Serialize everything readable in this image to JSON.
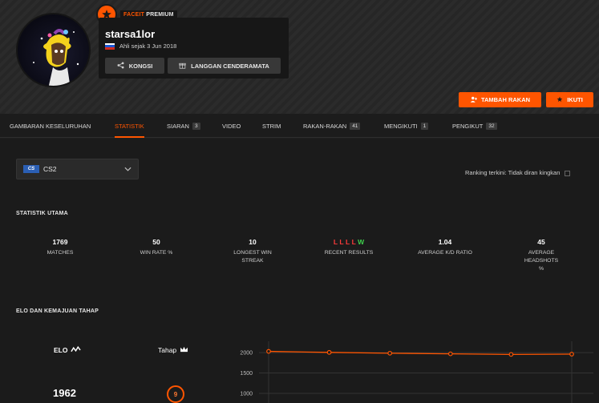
{
  "profile": {
    "badge_brand": "FACEIT",
    "badge_tier": "PREMIUM",
    "username": "starsa1lor",
    "member_since": "Ahli sejak 3 Jun 2018"
  },
  "actions": {
    "share_label": "KONGSI",
    "gift_label": "LANGGAN CENDERAMATA",
    "add_friend_label": "TAMBAH RAKAN",
    "follow_label": "IKUTI"
  },
  "tabs": [
    {
      "label": "GAMBARAN KESELURUHAN",
      "count": ""
    },
    {
      "label": "STATISTIK",
      "count": ""
    },
    {
      "label": "SIARAN",
      "count": "3"
    },
    {
      "label": "VIDEO",
      "count": ""
    },
    {
      "label": "STRIM",
      "count": ""
    },
    {
      "label": "RAKAN-RAKAN",
      "count": "41"
    },
    {
      "label": "MENGIKUTI",
      "count": "1"
    },
    {
      "label": "PENGIKUT",
      "count": "32"
    }
  ],
  "game": {
    "logo": "CS",
    "name": "CS2"
  },
  "ranking_text": "Ranking terkini: Tidak diran kingkan",
  "main_stats_title": "STATISTIK UTAMA",
  "stats": [
    {
      "value": "1769",
      "label": "MATCHES"
    },
    {
      "value": "50",
      "label": "WIN RATE %"
    },
    {
      "value": "10",
      "label": "LONGEST WIN STREAK"
    },
    {
      "value": "",
      "label": "RECENT RESULTS"
    },
    {
      "value": "1.04",
      "label": "AVERAGE K/D RATIO"
    },
    {
      "value": "45",
      "label": "AVERAGE HEADSHOTS %"
    }
  ],
  "recent_results": [
    "L",
    "L",
    "L",
    "L",
    "W"
  ],
  "elo_section_title": "ELO DAN KEMAJUAN TAHAP",
  "elo": {
    "label": "ELO",
    "value": "1962"
  },
  "level": {
    "label": "Tahap",
    "value": "9"
  },
  "colors": {
    "accent": "#ff5500",
    "win": "#3ed04c",
    "loss": "#ff3b3b"
  },
  "chart_data": {
    "type": "line",
    "x": [
      1,
      2,
      3,
      4,
      5,
      6
    ],
    "y": [
      2030,
      2005,
      1985,
      1970,
      1955,
      1962
    ],
    "ylim": [
      1000,
      2100
    ],
    "yticks": [
      1000,
      1500,
      2000
    ],
    "grid": true,
    "color": "#ff5500"
  }
}
